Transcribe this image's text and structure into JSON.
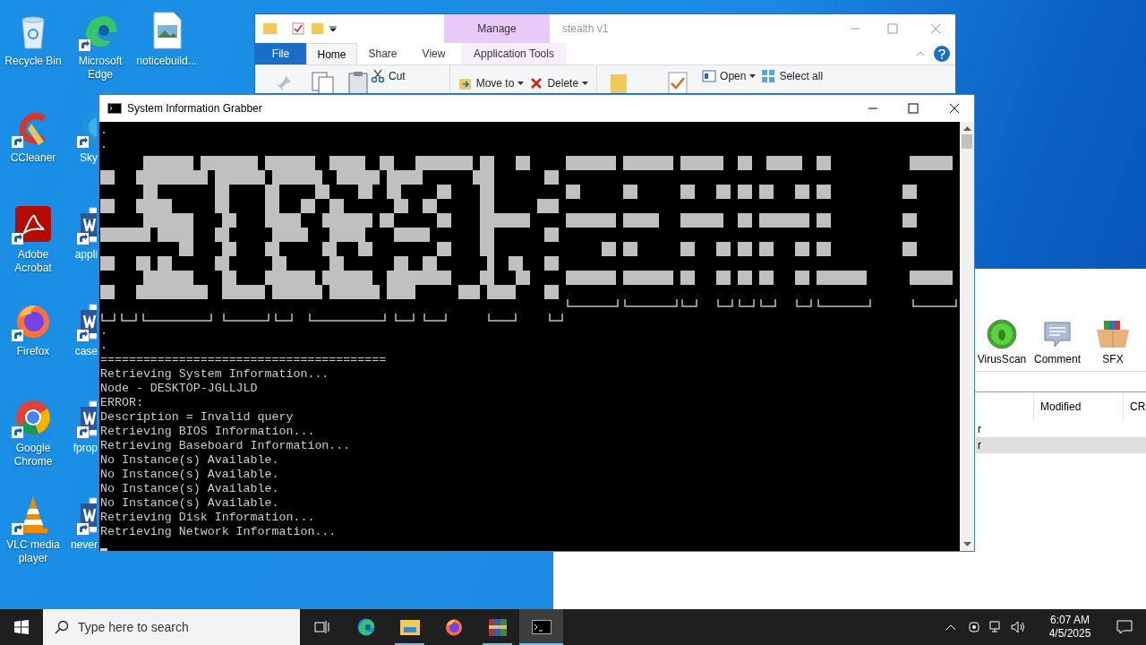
{
  "desktop": {
    "columns": [
      [
        {
          "label": "Recycle Bin",
          "kind": "recycle",
          "shortcut": false
        },
        {
          "label": "CCleaner",
          "kind": "ccleaner",
          "shortcut": true
        },
        {
          "label": "Adobe Acrobat",
          "kind": "acrobat",
          "shortcut": true
        },
        {
          "label": "Firefox",
          "kind": "firefox",
          "shortcut": true
        },
        {
          "label": "Google Chrome",
          "kind": "chrome",
          "shortcut": true
        },
        {
          "label": "VLC media player",
          "kind": "vlc",
          "shortcut": true
        }
      ],
      [
        {
          "label": "Microsoft Edge",
          "kind": "edge",
          "shortcut": true
        },
        {
          "label": "Sky",
          "kind": "skype",
          "shortcut": true
        },
        {
          "label": "appli",
          "kind": "word",
          "shortcut": true
        },
        {
          "label": "case",
          "kind": "word",
          "shortcut": true
        },
        {
          "label": "fprop",
          "kind": "word",
          "shortcut": true
        },
        {
          "label": "never",
          "kind": "word",
          "shortcut": true
        }
      ],
      [
        {
          "label": "noticebuild...",
          "kind": "image-file",
          "shortcut": false
        }
      ]
    ]
  },
  "explorer": {
    "title": "stealth v1",
    "context_group": "Manage",
    "tabs": [
      {
        "label": "File",
        "kind": "file",
        "selected": false
      },
      {
        "label": "Home",
        "kind": "normal",
        "selected": true
      },
      {
        "label": "Share",
        "kind": "normal",
        "selected": false
      },
      {
        "label": "View",
        "kind": "normal",
        "selected": false
      },
      {
        "label": "Application Tools",
        "kind": "context",
        "selected": false
      }
    ],
    "ribbon": [
      {
        "label": "Cut",
        "kind": "cut",
        "dropdown": false
      },
      {
        "label": "Move to",
        "kind": "move",
        "dropdown": true
      },
      {
        "label": "Delete",
        "kind": "delete",
        "dropdown": true
      },
      {
        "label": "Open",
        "kind": "open",
        "dropdown": true
      },
      {
        "label": "Select all",
        "kind": "select",
        "dropdown": false
      }
    ]
  },
  "console": {
    "title": "System Information Grabber",
    "lines_before_art": [
      ".",
      "."
    ],
    "lines_after_art": [
      ".",
      ".",
      "========================================",
      "Retrieving System Information...",
      "Node - DESKTOP-JGLLJLD",
      "ERROR:",
      "Description = Invalid query",
      "Retrieving BIOS Information...",
      "Retrieving Baseboard Information...",
      "No Instance(s) Available.",
      "No Instance(s) Available.",
      "No Instance(s) Available.",
      "No Instance(s) Available.",
      "Retrieving Disk Information...",
      "Retrieving Network Information..."
    ]
  },
  "archiver": {
    "toolbar": [
      {
        "label": "VirusScan",
        "kind": "virus"
      },
      {
        "label": "Comment",
        "kind": "comment"
      },
      {
        "label": "SFX",
        "kind": "sfx"
      }
    ],
    "columns": [
      "Modified",
      "CR"
    ],
    "rows": [
      {
        "text": "r",
        "selected": false
      },
      {
        "text": "r",
        "selected": true
      }
    ]
  },
  "taskbar": {
    "search_placeholder": "Type here to search",
    "apps": [
      {
        "kind": "taskview",
        "running": false,
        "selected": false
      },
      {
        "kind": "edge",
        "running": false,
        "selected": false
      },
      {
        "kind": "explorer",
        "running": true,
        "selected": false
      },
      {
        "kind": "firefox",
        "running": false,
        "selected": false
      },
      {
        "kind": "winrar",
        "running": true,
        "selected": false
      },
      {
        "kind": "console",
        "running": true,
        "selected": true
      }
    ],
    "time": "6:07 AM",
    "date": "4/5/2025"
  }
}
